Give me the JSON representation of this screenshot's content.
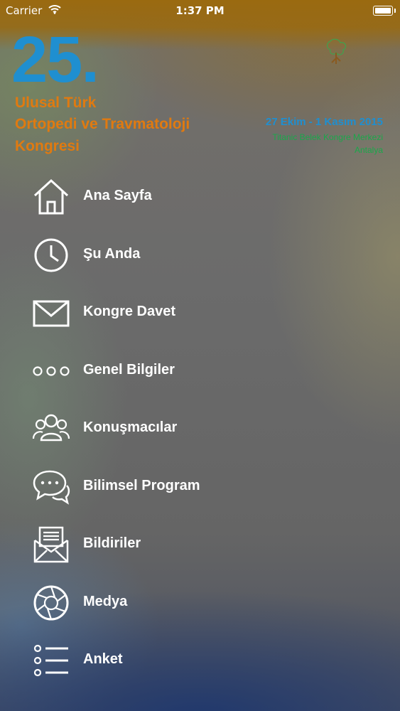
{
  "status_bar": {
    "carrier": "Carrier",
    "time": "1:37 PM"
  },
  "header": {
    "number": "25.",
    "title_lines": [
      "Ulusal Türk",
      "Ortopedi ve Travmatoloji",
      "Kongresi"
    ],
    "date": "27 Ekim - 1 Kasım 2015",
    "venue": "Titanic Belek Kongre Merkezi",
    "city": "Antalya",
    "colors": {
      "number": "#1f8fd0",
      "title": "#e07a10",
      "venue": "#1aa84a"
    }
  },
  "menu": {
    "items": [
      {
        "label": "Ana Sayfa",
        "icon": "home-icon"
      },
      {
        "label": "Şu Anda",
        "icon": "clock-icon"
      },
      {
        "label": "Kongre Davet",
        "icon": "envelope-icon"
      },
      {
        "label": "Genel Bilgiler",
        "icon": "more-dots-icon"
      },
      {
        "label": "Konuşmacılar",
        "icon": "people-icon"
      },
      {
        "label": "Bilimsel Program",
        "icon": "chat-bubbles-icon"
      },
      {
        "label": "Bildiriler",
        "icon": "open-letter-icon"
      },
      {
        "label": "Medya",
        "icon": "camera-aperture-icon"
      },
      {
        "label": "Anket",
        "icon": "list-icon"
      }
    ]
  }
}
